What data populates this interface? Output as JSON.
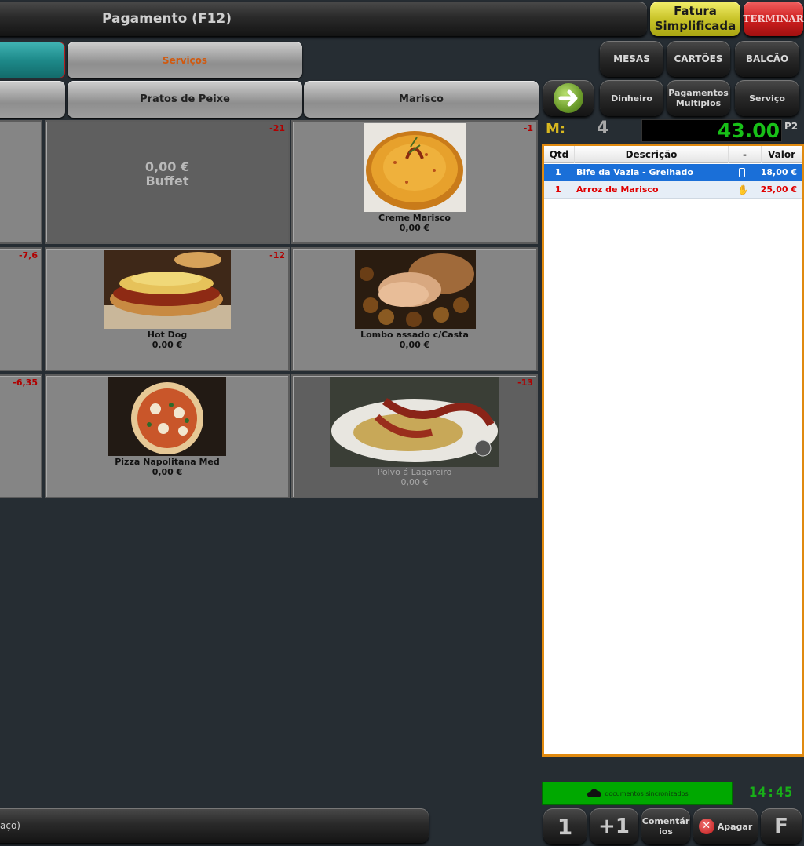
{
  "header": {
    "title": "Pagamento (F12)",
    "fatura_label": "Fatura Simplificada",
    "terminar_label": "TERMINAR"
  },
  "family_tabs": {
    "servicos_label": "Serviços"
  },
  "subfamily_tabs": {
    "peixe_label": "Pratos de Peixe",
    "marisco_label": "Marisco"
  },
  "right_buttons": {
    "mesas": "MESAS",
    "cartoes": "CARTÕES",
    "balcao": "BALCÃO",
    "dinheiro": "Dinheiro",
    "pagamentos_multiplos": "Pagamentos Multiplos",
    "servico": "Serviço"
  },
  "mesa": {
    "label": "M:",
    "number": "4",
    "total": "43.00",
    "price_level": "P2"
  },
  "order_table": {
    "headers": [
      "Qtd",
      "Descrição",
      "-",
      "Valor"
    ],
    "rows": [
      {
        "qty": "1",
        "description": "Bife da Vazia - Grelhado",
        "value": "18,00 €",
        "selected": true,
        "icon": "mobile-icon",
        "color": "#ffffff"
      },
      {
        "qty": "1",
        "description": "Arroz de Marisco",
        "value": "25,00 €",
        "selected": false,
        "icon": "hand-icon",
        "color": "#e00000"
      }
    ]
  },
  "products": [
    {
      "type": "text",
      "label_price": "0,00 €",
      "label_name": "Buffet",
      "badge": "-21"
    },
    {
      "type": "photo",
      "photo": "soup-photo",
      "name": "Creme Marisco",
      "price": "0,00 €",
      "badge": "-1"
    },
    {
      "type": "photo",
      "photo": "hotdog-photo",
      "name": "Hot Dog",
      "price": "0,00 €",
      "badge": "-12"
    },
    {
      "type": "photo",
      "photo": "roast-photo",
      "name": "Lombo assado c/Casta",
      "price": "0,00 €",
      "badge": ""
    },
    {
      "type": "photo",
      "photo": "pizza-photo",
      "name": "Pizza Napolitana Med",
      "price": "0,00 €",
      "badge": ""
    },
    {
      "type": "photo",
      "photo": "octopus-photo",
      "name": "Polvo á Lagareiro",
      "price": "0,00 €",
      "badge": "-13"
    }
  ],
  "left_partial_badges": [
    "-7,6",
    "-6,35"
  ],
  "sync": {
    "text": "documentos sincronizados",
    "time": "14:45"
  },
  "bottom": {
    "search_text": "aço)",
    "btn_1": "1",
    "btn_plus1": "+1",
    "comentarios": "Comentár ios",
    "apagar": "Apagar",
    "f": "F"
  },
  "colors": {
    "accent_teal": "#1e8a8a",
    "total_green": "#18c018",
    "sync_green": "#00a800",
    "order_border": "#e08a10",
    "selected_row": "#1a6fd8"
  }
}
